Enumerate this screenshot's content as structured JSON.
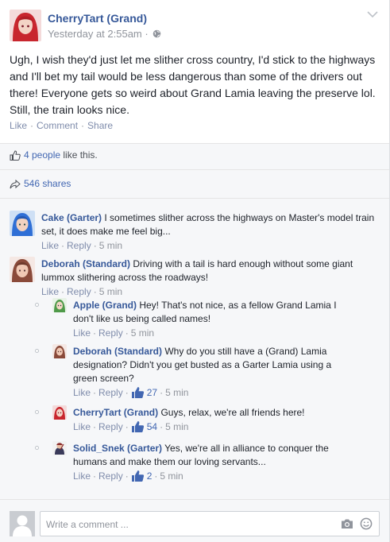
{
  "post": {
    "author": "CherryTart (Grand)",
    "timestamp": "Yesterday at 2:55am",
    "separator": "·",
    "text": "Ugh, I wish they'd just let me slither cross country, I'd stick to the highways and I'll bet my tail would be less dangerous than some of the drivers out there! Everyone gets so weird about Grand Lamia leaving the preserve lol. Still, the train looks nice.",
    "actions": {
      "like": "Like",
      "comment": "Comment",
      "share": "Share",
      "dot": "·"
    },
    "likes": {
      "people": "4 people",
      "suffix": " like this."
    },
    "shares": "546 shares",
    "icons": {
      "menu": "chevron-down-icon",
      "audience": "globe-icon",
      "like": "thumbs-up-icon",
      "share": "share-arrow-icon"
    }
  },
  "comments": [
    {
      "name": "Cake (Garter)",
      "text": " I sometimes slither across the highways on Master's model train set, it does make me feel big...",
      "like": "Like",
      "reply": "Reply",
      "time": "5 min",
      "likes": null,
      "avatar_colors": {
        "hair": "#2f6fd6",
        "skin": "#f2d2c0",
        "bg": "#cfe0f5"
      }
    },
    {
      "name": "Deborah (Standard)",
      "text": " Driving with a tail is hard enough without some giant lummox slithering across the roadways!",
      "like": "Like",
      "reply": "Reply",
      "time": "5 min",
      "likes": null,
      "avatar_colors": {
        "hair": "#8a4a3a",
        "skin": "#f0c8b4",
        "bg": "#f5e8e4"
      }
    }
  ],
  "replies": [
    {
      "name": "Apple (Grand)",
      "text": " Hey! That's not nice, as a fellow Grand Lamia I don't like us being called names!",
      "like": "Like",
      "reply": "Reply",
      "time": "5 min",
      "likes": null,
      "avatar_colors": {
        "hair": "#4f9a4a",
        "skin": "#f2d6c4",
        "bg": "#e8f3e6"
      }
    },
    {
      "name": "Deborah (Standard)",
      "text": " Why do you still have a (Grand) Lamia designation? Didn't you get busted as a Garter Lamia using a green screen?",
      "like": "Like",
      "reply": "Reply",
      "time": "5 min",
      "likes": "27",
      "avatar_colors": {
        "hair": "#8a4a3a",
        "skin": "#f0c8b4",
        "bg": "#f5e8e4"
      }
    },
    {
      "name": "CherryTart (Grand)",
      "text": " Guys, relax, we're all friends here!",
      "like": "Like",
      "reply": "Reply",
      "time": "5 min",
      "likes": "54",
      "avatar_colors": {
        "hair": "#c8262e",
        "skin": "#f3d4c6",
        "bg": "#f4dada"
      }
    },
    {
      "name": "Solid_Snek (Garter)",
      "text": " Yes, we're all in alliance to conquer the humans and make them our loving servants...",
      "like": "Like",
      "reply": "Reply",
      "time": "5 min",
      "likes": "2",
      "avatar_colors": {
        "hair": "#8a2a2a",
        "skin": "#e9c2a8",
        "bg": "#f2f2f2"
      }
    }
  ],
  "composer": {
    "placeholder": "Write a comment ...",
    "icons": {
      "camera": "camera-icon",
      "emoji": "smiley-icon",
      "avatar": "default-avatar-icon"
    }
  },
  "colors": {
    "link": "#365899",
    "action": "#7f8cab",
    "muted": "#90949c",
    "accent": "#4267b2"
  }
}
